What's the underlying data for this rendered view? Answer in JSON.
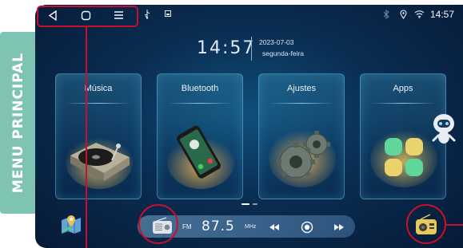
{
  "side_label": "MENU PRINCIPAL",
  "statusbar": {
    "icons": [
      "back-icon",
      "home-icon",
      "menu-icon",
      "usb-icon",
      "image-icon",
      "bluetooth-icon",
      "location-icon",
      "wifi-icon"
    ],
    "time": "14:57"
  },
  "clock": {
    "time": "14:57",
    "date": "2023-07-03",
    "weekday": "segunda-feira"
  },
  "tiles": [
    {
      "label": "Música",
      "icon": "turntable-icon"
    },
    {
      "label": "Bluetooth",
      "icon": "phone-call-icon"
    },
    {
      "label": "Ajustes",
      "icon": "gears-icon"
    },
    {
      "label": "Apps",
      "icon": "apps-grid-icon"
    }
  ],
  "radio": {
    "band": "FM",
    "frequency": "87.5",
    "unit": "MHz"
  },
  "colors": {
    "accent_red": "#c8102e",
    "side_tab": "#7fc3b3",
    "screen_bg": "#0a2d52"
  }
}
